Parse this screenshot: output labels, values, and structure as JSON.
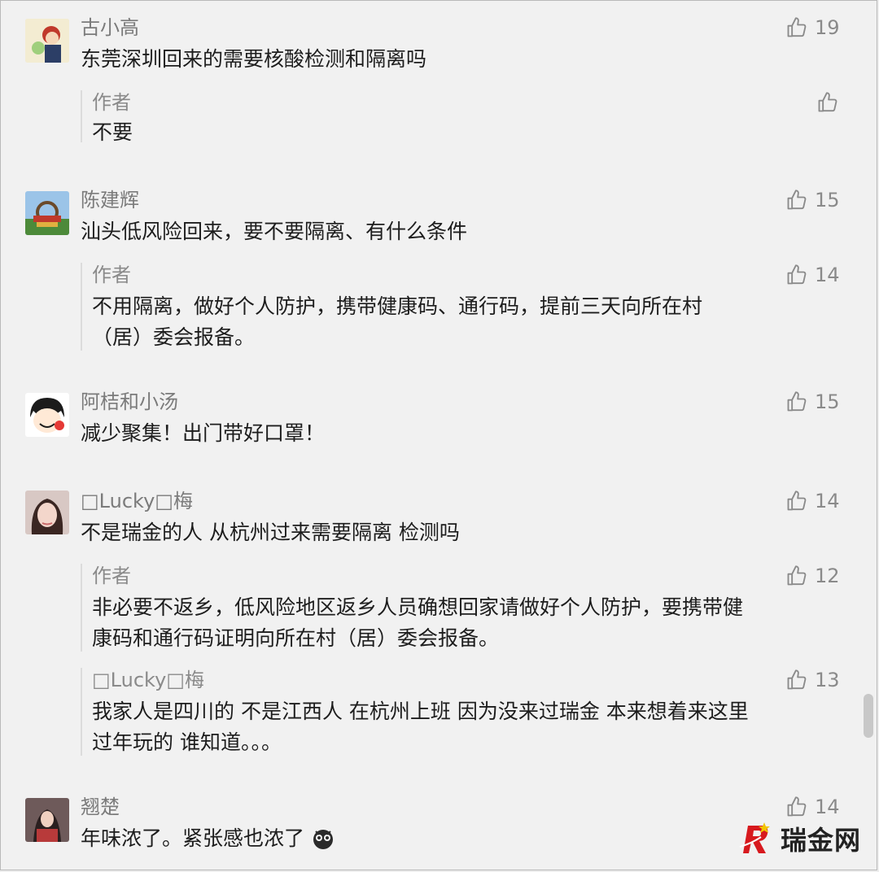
{
  "comments": [
    {
      "nick": "古小高",
      "text": "东莞深圳回来的需要核酸检测和隔离吗",
      "likes": "19",
      "reply": {
        "nick": "作者",
        "text": "不要",
        "likes": ""
      }
    },
    {
      "nick": "陈建辉",
      "text": "汕头低风险回来，要不要隔离、有什么条件",
      "likes": "15",
      "reply": {
        "nick": "作者",
        "text_line1": "不用隔离，做好个人防护，携带健康码、通行码，提前三天向所在村",
        "text_line2": "（居）委会报备。",
        "likes": "14"
      }
    },
    {
      "nick": "阿桔和小汤",
      "text": "减少聚集！出门带好口罩！",
      "likes": "15"
    },
    {
      "nick": "□Lucky□梅",
      "text": "不是瑞金的人 从杭州过来需要隔离 检测吗",
      "likes": "14",
      "reply": {
        "nick": "作者",
        "text_line1": "非必要不返乡，低风险地区返乡人员确想回家请做好个人防护，要携带健",
        "text_line2": "康码和通行码证明向所在村（居）委会报备。",
        "likes": "12"
      },
      "reply2": {
        "nick": "□Lucky□梅",
        "text_line1": "我家人是四川的 不是江西人 在杭州上班 因为没来过瑞金 本来想着来这里",
        "text_line2": "过年玩的 谁知道。。。",
        "likes": "13"
      }
    },
    {
      "nick": "翘楚",
      "text": "年味浓了。紧张感也浓了",
      "likes": "14"
    }
  ],
  "watermark": {
    "brand": "瑞金网",
    "letter": "R"
  },
  "colors": {
    "background": "#f1f1f1",
    "nick": "#7b7b7b",
    "text": "#1d1d1d",
    "logo_red": "#d7191e"
  }
}
